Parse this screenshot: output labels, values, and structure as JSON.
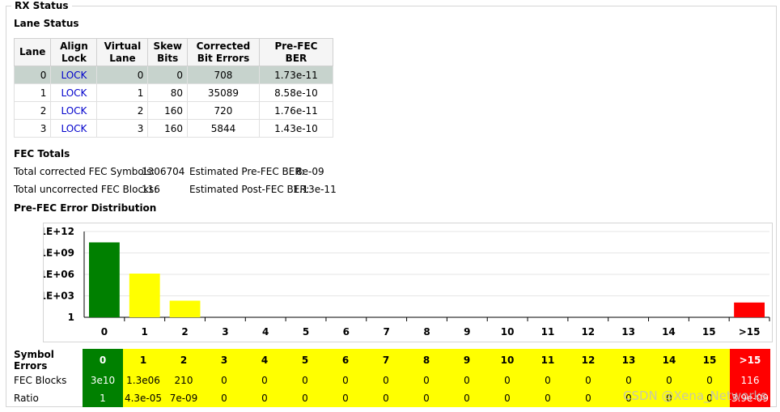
{
  "group_title": "RX Status",
  "lane_status": {
    "title": "Lane Status",
    "headers": [
      [
        "Lane"
      ],
      [
        "Align",
        "Lock"
      ],
      [
        "Virtual",
        "Lane"
      ],
      [
        "Skew",
        "Bits"
      ],
      [
        "Corrected",
        "Bit Errors"
      ],
      [
        "Pre-FEC",
        "BER"
      ]
    ],
    "rows": [
      {
        "lane": "0",
        "align_lock": "LOCK",
        "virtual_lane": "0",
        "skew_bits": "0",
        "corrected": "708",
        "pre_fec_ber": "1.73e-11"
      },
      {
        "lane": "1",
        "align_lock": "LOCK",
        "virtual_lane": "1",
        "skew_bits": "80",
        "corrected": "35089",
        "pre_fec_ber": "8.58e-10"
      },
      {
        "lane": "2",
        "align_lock": "LOCK",
        "virtual_lane": "2",
        "skew_bits": "160",
        "corrected": "720",
        "pre_fec_ber": "1.76e-11"
      },
      {
        "lane": "3",
        "align_lock": "LOCK",
        "virtual_lane": "3",
        "skew_bits": "160",
        "corrected": "5844",
        "pre_fec_ber": "1.43e-10"
      }
    ],
    "selected_row": 0
  },
  "fec_totals": {
    "title": "FEC Totals",
    "corrected_symbols_label": "Total corrected FEC Symbols:",
    "corrected_symbols_value": "1306704",
    "uncorrected_blocks_label": "Total uncorrected FEC Blocks:",
    "uncorrected_blocks_value": "116",
    "pre_fec_ber_label": "Estimated Pre-FEC BER:",
    "pre_fec_ber_value": "8e-09",
    "post_fec_ber_label": "Estimated Post-FEC BER:",
    "post_fec_ber_value": "1.13e-11"
  },
  "distribution": {
    "title": "Pre-FEC Error Distribution",
    "symbol_errors_label": "Symbol Errors",
    "fec_blocks_label": "FEC Blocks",
    "ratio_label": "Ratio",
    "symbol_errors": [
      "0",
      "1",
      "2",
      "3",
      "4",
      "5",
      "6",
      "7",
      "8",
      "9",
      "10",
      "11",
      "12",
      "13",
      "14",
      "15",
      ">15"
    ],
    "fec_blocks": [
      "3e10",
      "1.3e06",
      "210",
      "0",
      "0",
      "0",
      "0",
      "0",
      "0",
      "0",
      "0",
      "0",
      "0",
      "0",
      "0",
      "0",
      "116"
    ],
    "ratio": [
      "1",
      "4.3e-05",
      "7e-09",
      "0",
      "0",
      "0",
      "0",
      "0",
      "0",
      "0",
      "0",
      "0",
      "0",
      "0",
      "0",
      "0",
      "3.9e-09"
    ],
    "cell_colors": [
      "green",
      "yellow",
      "yellow",
      "yellow",
      "yellow",
      "yellow",
      "yellow",
      "yellow",
      "yellow",
      "yellow",
      "yellow",
      "yellow",
      "yellow",
      "yellow",
      "yellow",
      "yellow",
      "red"
    ]
  },
  "chart_data": {
    "type": "bar",
    "categories": [
      "0",
      "1",
      "2",
      "3",
      "4",
      "5",
      "6",
      "7",
      "8",
      "9",
      "10",
      "11",
      "12",
      "13",
      "14",
      "15",
      ">15"
    ],
    "values": [
      30000000000,
      1300000,
      210,
      0,
      0,
      0,
      0,
      0,
      0,
      0,
      0,
      0,
      0,
      0,
      0,
      0,
      116
    ],
    "y_scale": "log",
    "ylim": [
      1,
      1000000000000
    ],
    "y_ticks": [
      "1",
      "1E+03",
      "1E+06",
      "1E+09",
      "1E+12"
    ],
    "y_tick_values": [
      1,
      1000,
      1000000,
      1000000000,
      1000000000000
    ],
    "bar_colors": [
      "#008000",
      "#ffff00",
      "#ffff00",
      "#ffff00",
      "#ffff00",
      "#ffff00",
      "#ffff00",
      "#ffff00",
      "#ffff00",
      "#ffff00",
      "#ffff00",
      "#ffff00",
      "#ffff00",
      "#ffff00",
      "#ffff00",
      "#ffff00",
      "#ff0000"
    ],
    "grid": true
  },
  "watermark": "CSDN @Xena_Networks"
}
